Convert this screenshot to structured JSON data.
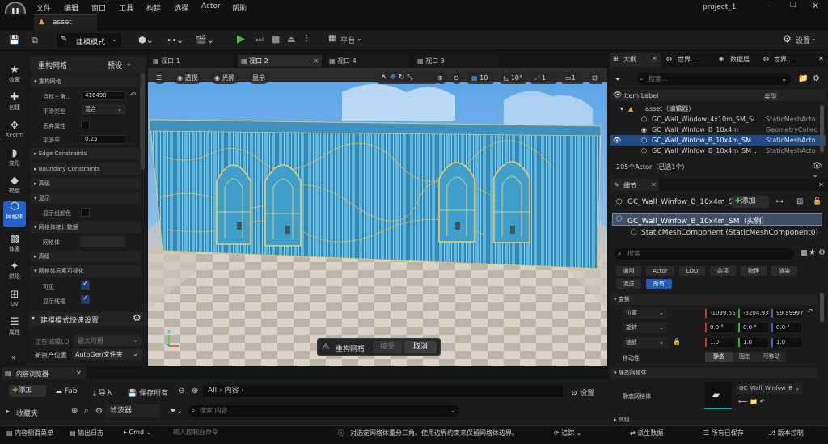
{
  "app": {
    "project": "project_1",
    "asset_tab": "asset",
    "logo": "U"
  },
  "menu": [
    "文件",
    "编辑",
    "窗口",
    "工具",
    "构建",
    "选择",
    "Actor",
    "帮助"
  ],
  "toolbar": {
    "mode": "建模模式",
    "platform": "平台",
    "settings": "设置"
  },
  "leftbar": [
    {
      "icon": "star-icon",
      "label": "收藏"
    },
    {
      "icon": "create-icon",
      "label": "创建"
    },
    {
      "icon": "xform-icon",
      "label": "XForm"
    },
    {
      "icon": "deform-icon",
      "label": "变形"
    },
    {
      "icon": "model-icon",
      "label": "模型"
    },
    {
      "icon": "mesh-icon",
      "label": "网格体"
    },
    {
      "icon": "voxel-icon",
      "label": "体素"
    },
    {
      "icon": "bake-icon",
      "label": "烘焙"
    },
    {
      "icon": "uv-icon",
      "label": "UV"
    },
    {
      "icon": "attributes-icon",
      "label": "属性"
    }
  ],
  "leftpanel": {
    "title": "重构网格",
    "preset": "预设",
    "sec_remesh": "重构网格",
    "target_tri_label": "目标三角...",
    "target_tri_value": "416490",
    "smooth_type_label": "平滑类型",
    "smooth_type_value": "混合",
    "discard_attr_label": "丢弃属性",
    "smooth_rate_label": "平滑率",
    "smooth_rate_value": "0.25",
    "edge_constraints": "Edge Constraints",
    "boundary_constraints": "Boundary Constraints",
    "advanced1": "高级",
    "display": "显示",
    "show_group_color": "显示组颜色",
    "mesh_stats": "网格体统计数据",
    "mesh_label": "网格体",
    "advanced2": "高级",
    "mesh_vis": "网格体元素可视化",
    "visible": "可见",
    "show_wireframe": "显示线框",
    "quick_settings": "建模模式快速设置",
    "editing_label": "正在编辑LO",
    "editing_value": "最大可用",
    "new_asset_label": "新资产位置",
    "new_asset_value": "AutoGen文件夹"
  },
  "viewport_tabs": [
    "视口 1",
    "视口 2",
    "视口 4",
    "视口 3"
  ],
  "viewport": {
    "perspective": "透视",
    "lighting": "光照",
    "show": "显示",
    "grid": "10",
    "angle": "10°",
    "scale": "1",
    "camera": "1",
    "dialog_title": "重构网格",
    "accept": "接受",
    "cancel": "取消"
  },
  "outliner": {
    "tabs": [
      "大纲",
      "世界...",
      "数据层",
      "世界..."
    ],
    "search_placeholder": "搜索...",
    "col_label": "Item Label",
    "col_type": "类型",
    "rows": [
      {
        "label": "asset（编辑器）",
        "type": ""
      },
      {
        "label": "GC_Wall_Window_4x10m_SM_Sı",
        "type": "StaticMeshActo"
      },
      {
        "label": "GC_Wall_Winfow_B_10x4m",
        "type": "GeometryCollec"
      },
      {
        "label": "GC_Wall_Winfow_B_10x4m_SM",
        "type": "StaticMeshActo"
      },
      {
        "label": "GC_Wall_Winfow_B_10x4m_SM_:",
        "type": "StaticMeshActo"
      }
    ],
    "count": "205个Actor（已选1个）"
  },
  "details": {
    "tab": "细节",
    "actor_name": "GC_Wall_Winfow_B_10x4m_S",
    "add": "添加",
    "instance": "GC_Wall_Winfow_B_10x4m_SM（实例）",
    "component": "StaticMeshComponent (StaticMeshComponent0)",
    "search_placeholder": "搜索",
    "categories": [
      "通用",
      "Actor",
      "LOD",
      "杂项",
      "物理",
      "渲染",
      "流送",
      "所有"
    ],
    "transform": "变换",
    "location": "位置",
    "loc": [
      "-1099.55",
      "-6204.93",
      "99.99997"
    ],
    "rotation": "旋转",
    "rot": [
      "0.0 °",
      "0.0 °",
      "0.0 °"
    ],
    "scale": "缩放",
    "scl": [
      "1.0",
      "1.0",
      "1.0"
    ],
    "mobility": "移动性",
    "mob": [
      "静态",
      "固定",
      "可移动"
    ],
    "static_mesh_section": "静态网格体",
    "static_mesh_label": "静态网格体",
    "static_mesh_value": "GC_Wall_Winfow_B",
    "advanced": "高级"
  },
  "content_browser": {
    "tab": "内容浏览器",
    "add": "添加",
    "fab": "Fab",
    "import": "导入",
    "save_all": "保存所有",
    "path": [
      "All",
      "内容"
    ],
    "settings": "设置",
    "favorites": "收藏夹",
    "filters": "滤波器",
    "search_placeholder": "搜索 内容"
  },
  "statusbar": {
    "drawer": "内容侧滑菜单",
    "output": "输出日志",
    "cmd": "Cmd",
    "cmd_placeholder": "输入控制台命令",
    "hint": "对选定网格体重分三角。使用边界约束来保留网格体边界。",
    "trace": "追踪",
    "derived": "派生数据",
    "save_all": "所有已保存",
    "vcs": "版本控制"
  }
}
